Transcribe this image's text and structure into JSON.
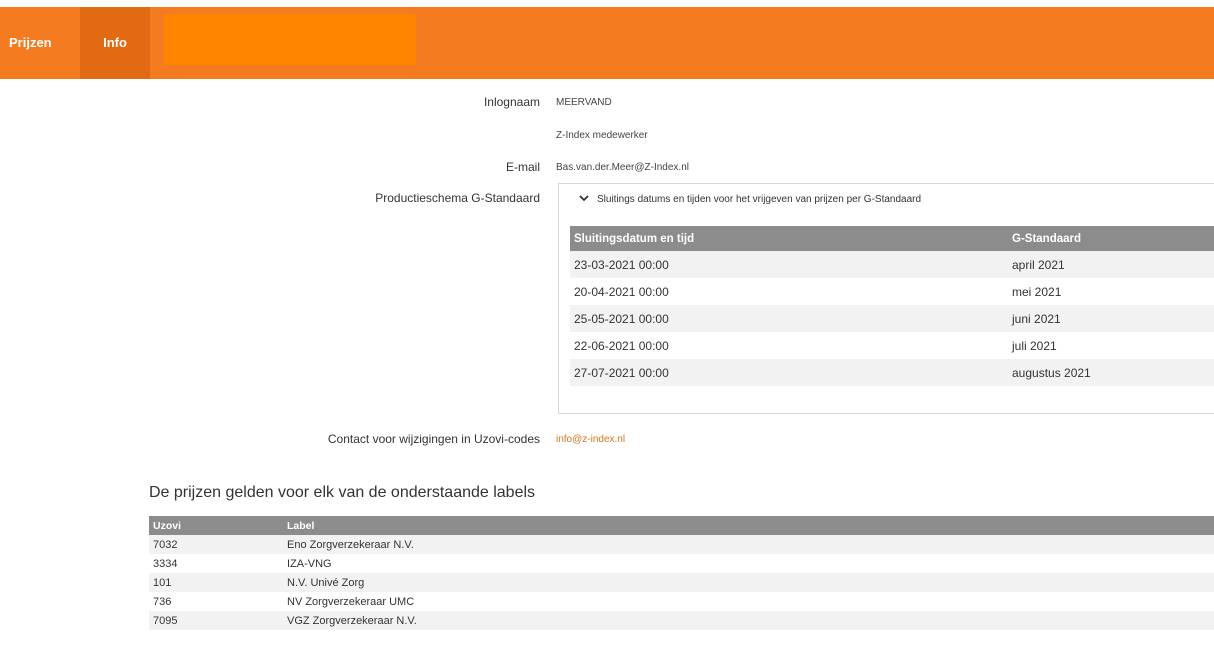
{
  "nav": {
    "items": [
      {
        "label": "Prijzen"
      },
      {
        "label": "Info"
      }
    ]
  },
  "colors": {
    "brand": "#f47b20",
    "active_tab": "#e26a12",
    "link": "#d4741b",
    "table_header": "#8c8c8c"
  },
  "info": {
    "login_label": "Inlognaam",
    "login_value": "MEERVAND",
    "role_value": "Z-Index medewerker",
    "email_label": "E-mail",
    "email_value": "Bas.van.der.Meer@Z-Index.nl",
    "schedule_label": "Productieschema G-Standaard",
    "contact_label": "Contact voor wijzigingen in Uzovi-codes",
    "contact_value": "info@z-index.nl"
  },
  "schedule": {
    "toggle_icon": "chevron-down-icon",
    "heading": "Sluitings datums en tijden voor het vrijgeven van prijzen per G-Standaard",
    "columns": [
      "Sluitingsdatum en tijd",
      "G-Standaard"
    ],
    "rows": [
      [
        "23-03-2021 00:00",
        "april 2021"
      ],
      [
        "20-04-2021 00:00",
        "mei 2021"
      ],
      [
        "25-05-2021 00:00",
        "juni 2021"
      ],
      [
        "22-06-2021 00:00",
        "juli 2021"
      ],
      [
        "27-07-2021 00:00",
        "augustus 2021"
      ]
    ]
  },
  "labels_section": {
    "title": "De prijzen gelden voor elk van de onderstaande labels",
    "columns": [
      "Uzovi",
      "Label"
    ],
    "rows": [
      [
        "7032",
        "Eno Zorgverzekeraar N.V."
      ],
      [
        "3334",
        "IZA-VNG"
      ],
      [
        "101",
        "N.V. Univé Zorg"
      ],
      [
        "736",
        "NV Zorgverzekeraar UMC"
      ],
      [
        "7095",
        "VGZ Zorgverzekeraar N.V."
      ]
    ]
  }
}
